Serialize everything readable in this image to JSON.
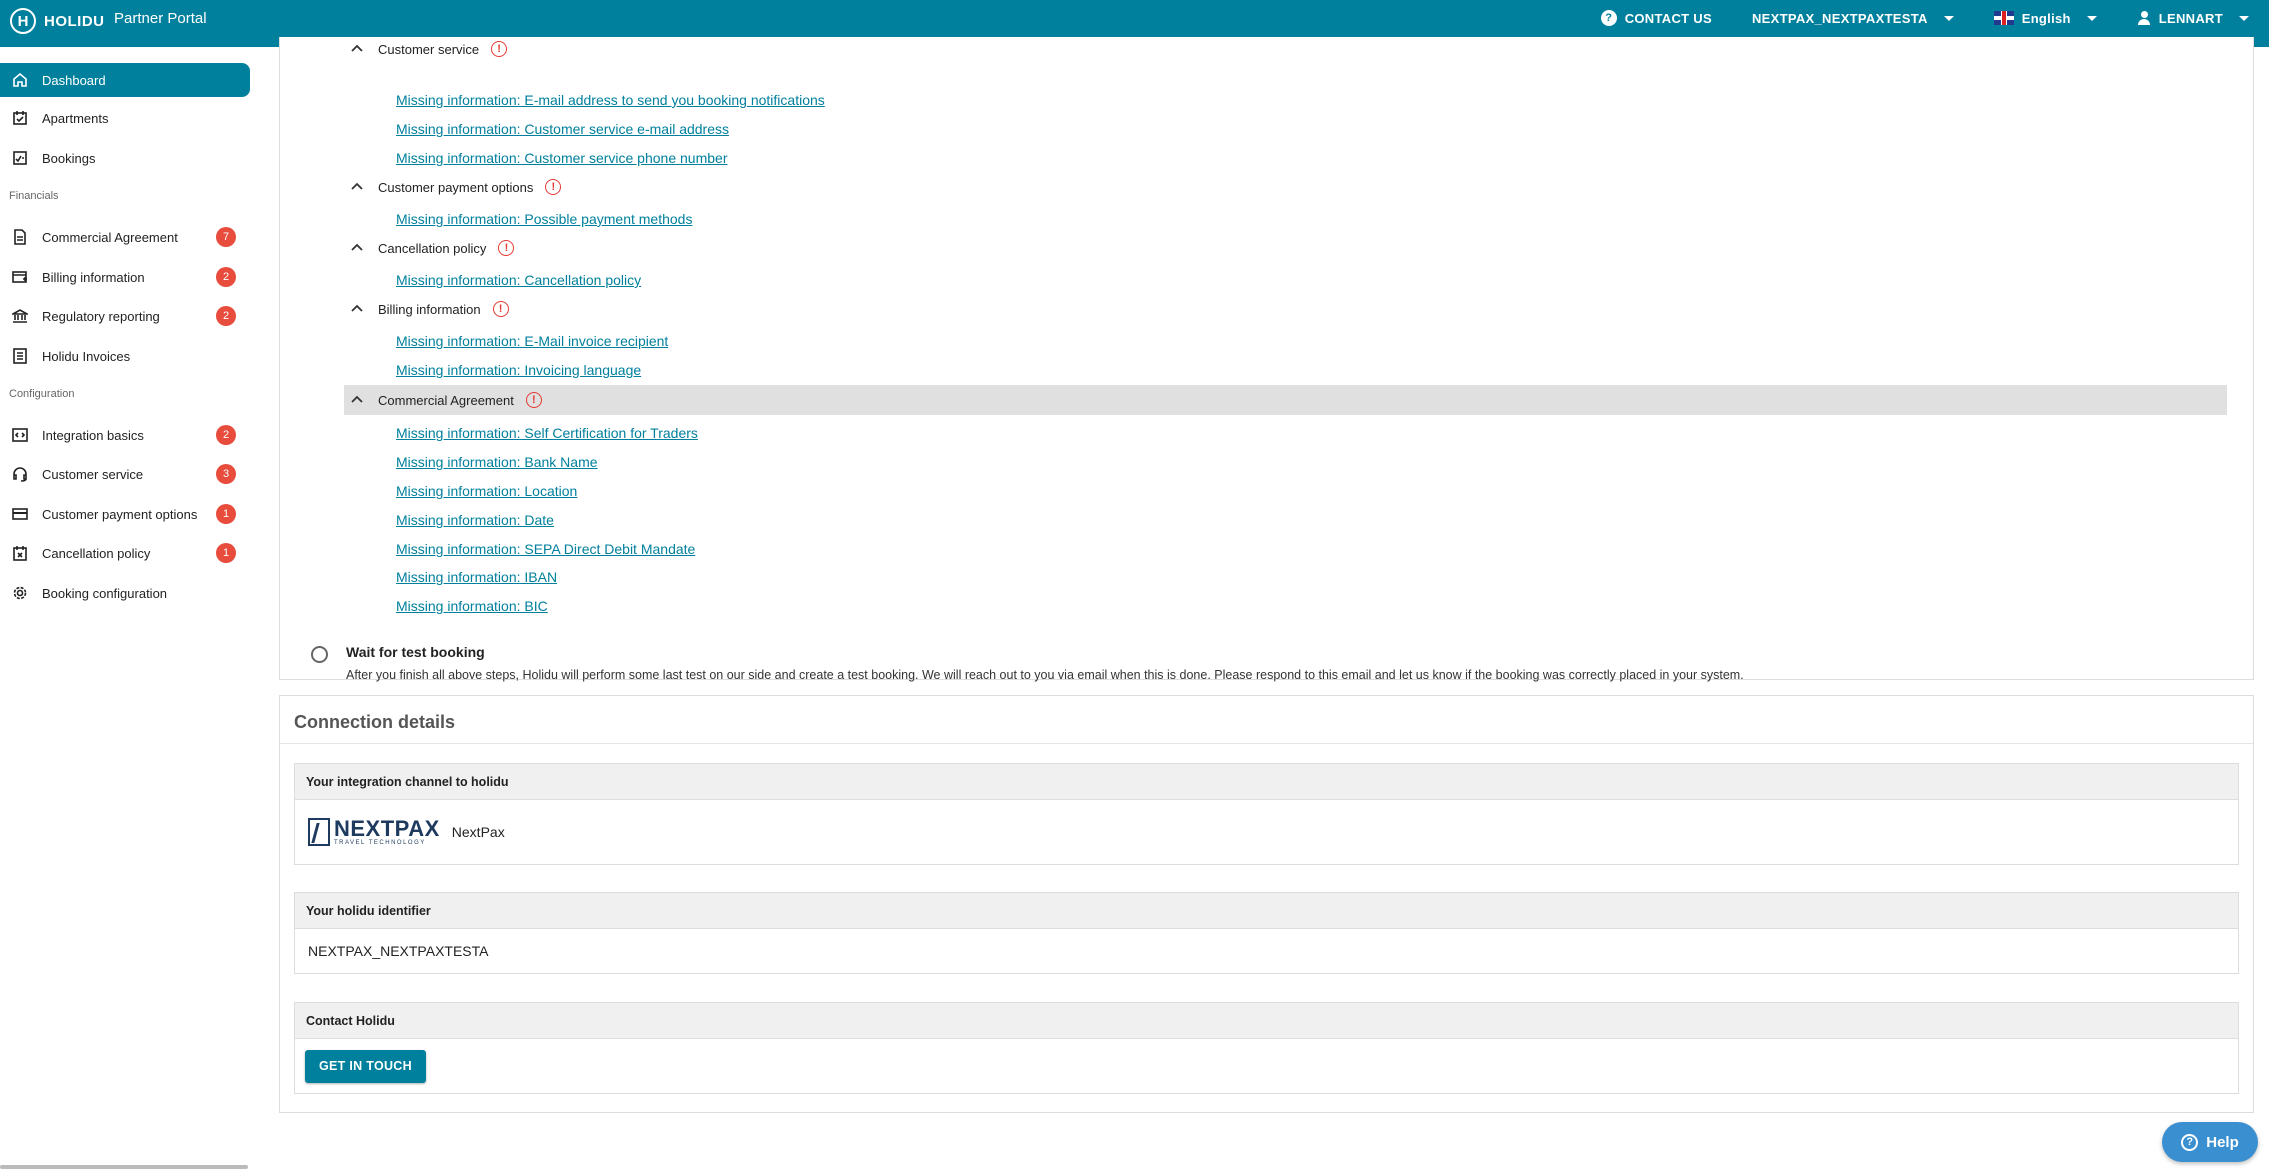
{
  "topbar": {
    "logo_mark": "H",
    "logo_text": "HOLIDU",
    "portal_title": "Partner Portal",
    "contact_label": "CONTACT US",
    "account_label": "NEXTPAX_NEXTPAXTESTA",
    "language_label": "English",
    "user_label": "LENNART"
  },
  "sidebar": {
    "items": [
      {
        "label": "Dashboard"
      },
      {
        "label": "Apartments"
      },
      {
        "label": "Bookings"
      },
      {
        "label": "Commercial Agreement",
        "badge": "7"
      },
      {
        "label": "Billing information",
        "badge": "2"
      },
      {
        "label": "Regulatory reporting",
        "badge": "2"
      },
      {
        "label": "Holidu Invoices"
      },
      {
        "label": "Integration basics",
        "badge": "2"
      },
      {
        "label": "Customer service",
        "badge": "3"
      },
      {
        "label": "Customer payment options",
        "badge": "1"
      },
      {
        "label": "Cancellation policy",
        "badge": "1"
      },
      {
        "label": "Booking configuration"
      }
    ],
    "sections": {
      "financials": "Financials",
      "configuration": "Configuration"
    }
  },
  "checklist": {
    "groups": [
      {
        "label": "Customer service",
        "links": [
          "Missing information: E-mail address to send you booking notifications",
          "Missing information: Customer service e-mail address",
          "Missing information: Customer service phone number"
        ]
      },
      {
        "label": "Customer payment options",
        "links": [
          "Missing information: Possible payment methods"
        ]
      },
      {
        "label": "Cancellation policy",
        "links": [
          "Missing information: Cancellation policy"
        ]
      },
      {
        "label": "Billing information",
        "links": [
          "Missing information: E-Mail invoice recipient",
          "Missing information: Invoicing language"
        ]
      },
      {
        "label": "Commercial Agreement",
        "links": [
          "Missing information: Self Certification for Traders",
          "Missing information: Bank Name",
          "Missing information: Location",
          "Missing information: Date",
          "Missing information: SEPA Direct Debit Mandate",
          "Missing information: IBAN",
          "Missing information: BIC"
        ]
      }
    ],
    "warn_symbol": "!",
    "step": {
      "title": "Wait for test booking",
      "description": "After you finish all above steps, Holidu will perform some last test on our side and create a test booking. We will reach out to you via email when this is done. Please respond to this email and let us know if the booking was correctly placed in your system."
    }
  },
  "connection": {
    "title": "Connection details",
    "channel_header": "Your integration channel to holidu",
    "channel_logo_big": "NEXTPAX",
    "channel_logo_small": "TRAVEL TECHNOLOGY",
    "channel_name": "NextPax",
    "identifier_header": "Your holidu identifier",
    "identifier_value": "NEXTPAX_NEXTPAXTESTA",
    "contact_header": "Contact Holidu",
    "contact_button": "GET IN TOUCH"
  },
  "help": {
    "label": "Help",
    "symbol": "?"
  }
}
